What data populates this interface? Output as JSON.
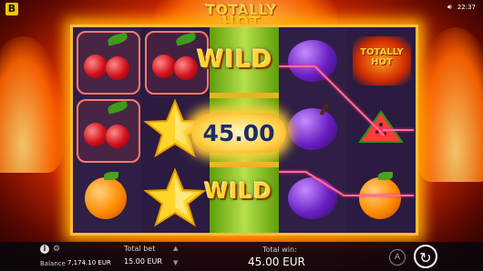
{
  "top_bar": {
    "time": "22:37",
    "logo_letter": "B"
  },
  "game_title": {
    "line1": "TOTALLY",
    "line2": "HOT"
  },
  "reels": {
    "symbols": [
      [
        "cherry",
        "cherry",
        "orange"
      ],
      [
        "cherry",
        "star",
        "star"
      ],
      [
        "wild",
        "wild",
        "wild"
      ],
      [
        "plum",
        "plum",
        "plum"
      ],
      [
        "totally-hot",
        "watermelon",
        "orange"
      ]
    ],
    "wild_label": "WILD",
    "symbol_text": "TOTALLY HOT"
  },
  "win": {
    "amount": "45.00"
  },
  "bottom_bar": {
    "balance_label": "Balance",
    "balance_value": "7,174.10 EUR",
    "total_bet_label": "Total bet",
    "total_bet_value": "15.00 EUR",
    "total_win_label": "Total win:",
    "total_win_value": "45.00 EUR",
    "autoplay_letter": "A"
  },
  "colors": {
    "win_line": "#ff6da0",
    "frame": "#ffbb3d",
    "wild_gold": "#ffd535",
    "badge_text": "#1c2c66"
  }
}
